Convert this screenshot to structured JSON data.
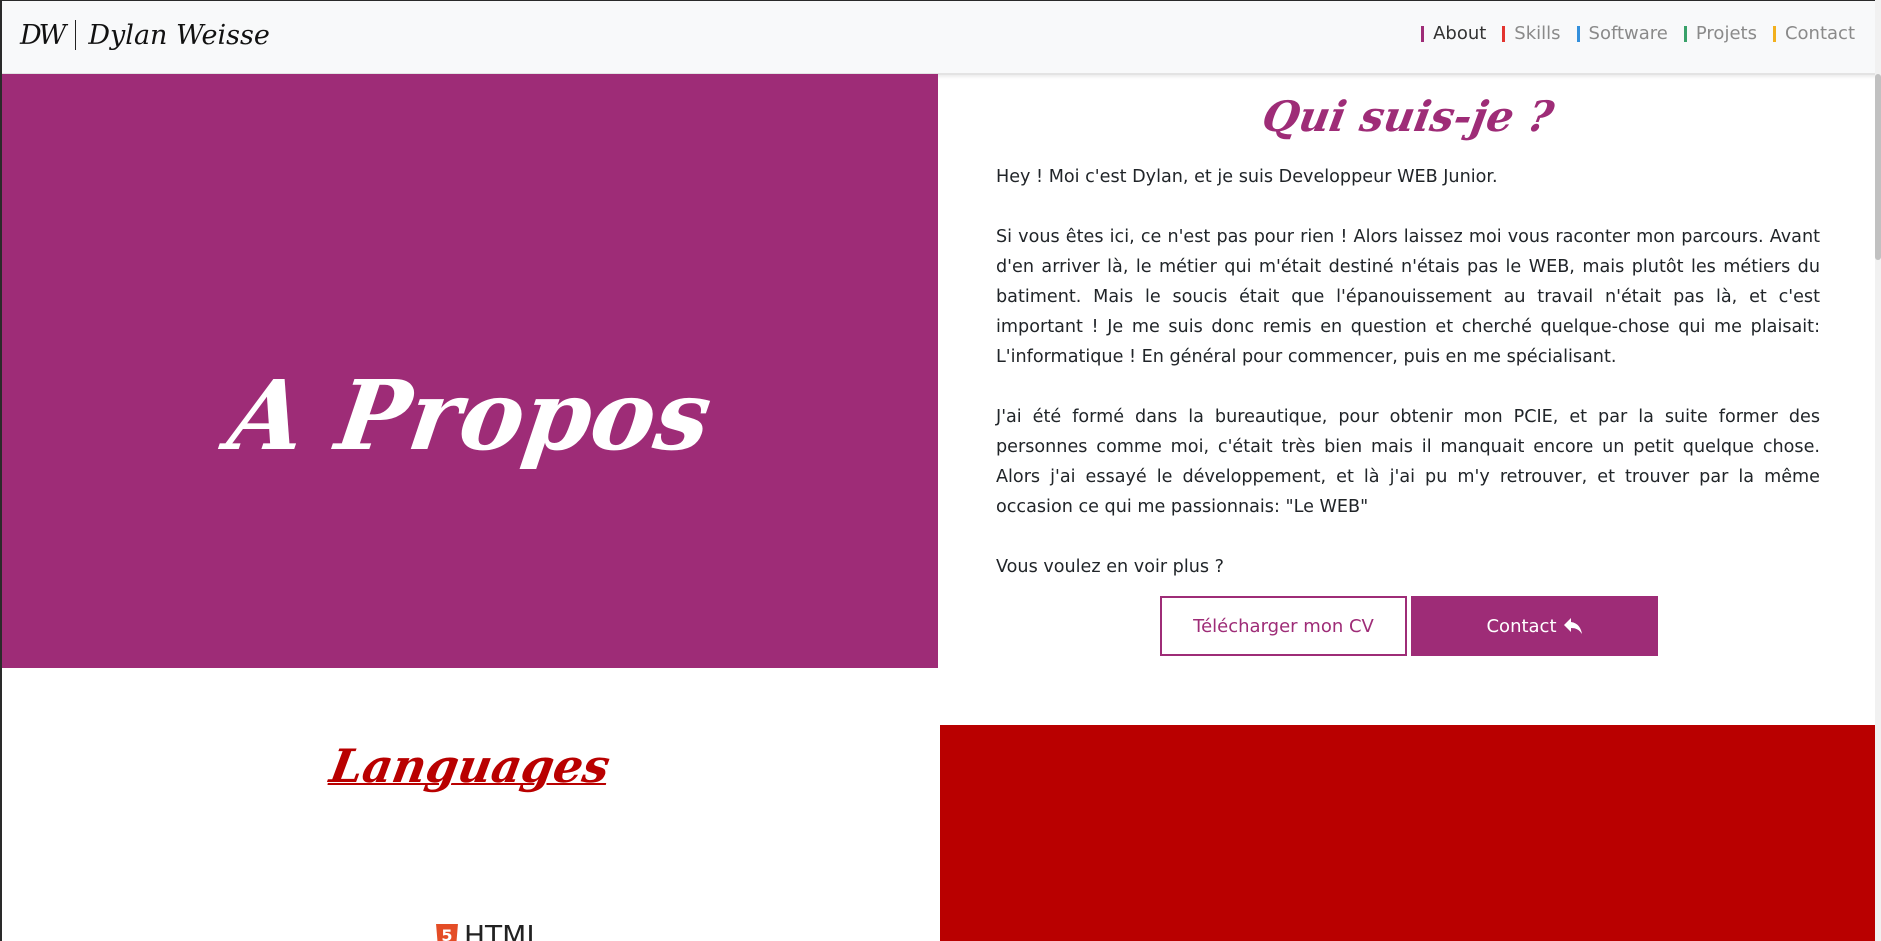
{
  "navbar": {
    "brand_logo": "DW",
    "brand_name": "Dylan Weisse",
    "items": [
      {
        "label": "About",
        "color": "#9e2c77"
      },
      {
        "label": "Skills",
        "color": "#e3342f"
      },
      {
        "label": "Software",
        "color": "#3490dc"
      },
      {
        "label": "Projets",
        "color": "#38a169"
      },
      {
        "label": "Contact",
        "color": "#f2b01e"
      }
    ]
  },
  "about": {
    "banner_title": "A Propos",
    "heading": "Qui suis-je ?",
    "paragraphs": [
      "Hey ! Moi c'est Dylan, et je suis Developpeur WEB Junior.",
      "Si vous êtes ici, ce n'est pas pour rien ! Alors laissez moi vous raconter mon parcours. Avant d'en arriver là, le métier qui m'était destiné n'étais pas le WEB, mais plutôt les métiers du batiment. Mais le soucis était que l'épanouissement au travail n'était pas là, et c'est important ! Je me suis donc remis en question et cherché quelque-chose qui me plaisait: L'informatique ! En général pour commencer, puis en me spécialisant.",
      "J'ai été formé dans la bureautique, pour obtenir mon PCIE, et par la suite former des personnes comme moi, c'était très bien mais il manquait encore un petit quelque chose. Alors j'ai essayé le développement, et là j'ai pu m'y retrouver, et trouver par la même occasion ce qui me passionnais: \"Le WEB\"",
      "Vous voulez en voir plus ?"
    ],
    "cv_button": "Télécharger mon CV",
    "contact_button": "Contact",
    "accent_color": "#9e2c77"
  },
  "skills": {
    "heading": "Languages",
    "first_language": "HTML",
    "accent_color": "#b90000"
  }
}
